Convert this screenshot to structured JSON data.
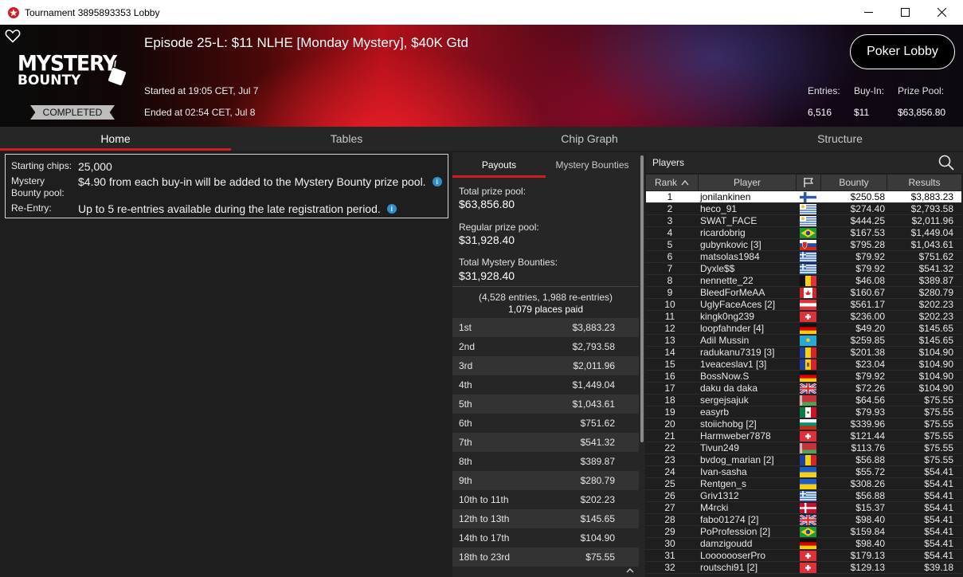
{
  "window": {
    "title": "Tournament 3895893353 Lobby"
  },
  "header": {
    "episode_title": "Episode 25-L: $11 NLHE [Monday Mystery], $40K Gtd",
    "started": "Started at 19:05 CET, Jul 7",
    "ended": "Ended at 02:54 CET, Jul 8",
    "status": "COMPLETED",
    "logo_text_1": "MYSTERY",
    "logo_text_2": "BOUNTY",
    "poker_lobby_label": "Poker Lobby",
    "entries_label": "Entries:",
    "entries_value": "6,516",
    "buyin_label": "Buy-In:",
    "buyin_value": "$11",
    "prizepool_label": "Prize Pool:",
    "prizepool_value": "$63,856.80"
  },
  "tabs": [
    "Home",
    "Tables",
    "Chip Graph",
    "Structure"
  ],
  "home_info": {
    "starting_chips_label": "Starting chips:",
    "starting_chips_value": "25,000",
    "mystery_label_1": "Mystery",
    "mystery_label_2": "Bounty pool:",
    "mystery_value": "$4.90 from each buy-in will be added to the Mystery Bounty prize pool.",
    "reentry_label": "Re-Entry:",
    "reentry_value": "Up to 5 re-entries available during the late registration period."
  },
  "payouts": {
    "tabs": [
      "Payouts",
      "Mystery Bounties"
    ],
    "total_prize_pool_label": "Total prize pool:",
    "total_prize_pool_value": "$63,856.80",
    "regular_prize_pool_label": "Regular prize pool:",
    "regular_prize_pool_value": "$31,928.40",
    "total_mystery_label": "Total Mystery Bounties:",
    "total_mystery_value": "$31,928.40",
    "entries_note": "(4,528 entries, 1,988 re-entries)",
    "places_paid": "1,079 places paid",
    "rows": [
      {
        "place": "1st",
        "amount": "$3,883.23"
      },
      {
        "place": "2nd",
        "amount": "$2,793.58"
      },
      {
        "place": "3rd",
        "amount": "$2,011.96"
      },
      {
        "place": "4th",
        "amount": "$1,449.04"
      },
      {
        "place": "5th",
        "amount": "$1,043.61"
      },
      {
        "place": "6th",
        "amount": "$751.62"
      },
      {
        "place": "7th",
        "amount": "$541.32"
      },
      {
        "place": "8th",
        "amount": "$389.87"
      },
      {
        "place": "9th",
        "amount": "$280.79"
      },
      {
        "place": "10th to 11th",
        "amount": "$202.23"
      },
      {
        "place": "12th to 13th",
        "amount": "$145.65"
      },
      {
        "place": "14th to 17th",
        "amount": "$104.90"
      },
      {
        "place": "18th to 23rd",
        "amount": "$75.55"
      }
    ]
  },
  "players": {
    "title": "Players",
    "columns": [
      "Rank",
      "Player",
      "Bounty",
      "Results"
    ],
    "rows": [
      {
        "rank": "1",
        "name": "jonilankinen",
        "flag": "fi",
        "bounty": "$250.58",
        "result": "$3,883.23"
      },
      {
        "rank": "2",
        "name": "heco_91",
        "flag": "uy",
        "bounty": "$274.40",
        "result": "$2,793.58"
      },
      {
        "rank": "3",
        "name": "SWAT_FACE",
        "flag": "uy",
        "bounty": "$444.25",
        "result": "$2,011.96"
      },
      {
        "rank": "4",
        "name": "ricardobrig",
        "flag": "br",
        "bounty": "$167.53",
        "result": "$1,449.04"
      },
      {
        "rank": "5",
        "name": "gubynkovic [3]",
        "flag": "sk",
        "bounty": "$795.28",
        "result": "$1,043.61"
      },
      {
        "rank": "6",
        "name": "matsolas1984",
        "flag": "gr",
        "bounty": "$79.92",
        "result": "$751.62"
      },
      {
        "rank": "7",
        "name": "Dyxle$$",
        "flag": "gr",
        "bounty": "$79.92",
        "result": "$541.32"
      },
      {
        "rank": "8",
        "name": "nennette_22",
        "flag": "be",
        "bounty": "$46.08",
        "result": "$389.87"
      },
      {
        "rank": "9",
        "name": "BleedForMeAA",
        "flag": "ca",
        "bounty": "$160.67",
        "result": "$280.79"
      },
      {
        "rank": "10",
        "name": "UglyFaceAces [2]",
        "flag": "at",
        "bounty": "$561.17",
        "result": "$202.23"
      },
      {
        "rank": "11",
        "name": "kingk0ng239",
        "flag": "ch",
        "bounty": "$236.00",
        "result": "$202.23"
      },
      {
        "rank": "12",
        "name": "loopfahnder [4]",
        "flag": "de",
        "bounty": "$49.20",
        "result": "$145.65"
      },
      {
        "rank": "13",
        "name": "Adil Mussin",
        "flag": "kz",
        "bounty": "$259.85",
        "result": "$145.65"
      },
      {
        "rank": "14",
        "name": "radukanu7319 [3]",
        "flag": "ro",
        "bounty": "$201.38",
        "result": "$104.90"
      },
      {
        "rank": "15",
        "name": "1veaceslav1 [3]",
        "flag": "md",
        "bounty": "$23.04",
        "result": "$104.90"
      },
      {
        "rank": "16",
        "name": "BossNow.S",
        "flag": "de",
        "bounty": "$79.92",
        "result": "$104.90"
      },
      {
        "rank": "17",
        "name": "daku da daka",
        "flag": "gb",
        "bounty": "$72.26",
        "result": "$104.90"
      },
      {
        "rank": "18",
        "name": "sergejsajuk",
        "flag": "by",
        "bounty": "$64.56",
        "result": "$75.55"
      },
      {
        "rank": "19",
        "name": "easyrb",
        "flag": "mx",
        "bounty": "$79.93",
        "result": "$75.55"
      },
      {
        "rank": "20",
        "name": "stoiichobg [2]",
        "flag": "bg",
        "bounty": "$339.96",
        "result": "$75.55"
      },
      {
        "rank": "21",
        "name": "Harmweber7878",
        "flag": "ch",
        "bounty": "$121.44",
        "result": "$75.55"
      },
      {
        "rank": "22",
        "name": "Tivun249",
        "flag": "by",
        "bounty": "$113.76",
        "result": "$75.55"
      },
      {
        "rank": "23",
        "name": "bvdog_marian [2]",
        "flag": "ro",
        "bounty": "$56.88",
        "result": "$75.55"
      },
      {
        "rank": "24",
        "name": "Ivan-sasha",
        "flag": "ua",
        "bounty": "$55.72",
        "result": "$54.41"
      },
      {
        "rank": "25",
        "name": "Rentgen_s",
        "flag": "ua",
        "bounty": "$308.26",
        "result": "$54.41"
      },
      {
        "rank": "26",
        "name": "Griv1312",
        "flag": "gr",
        "bounty": "$56.88",
        "result": "$54.41"
      },
      {
        "rank": "27",
        "name": "M4rcki",
        "flag": "dk",
        "bounty": "$15.37",
        "result": "$54.41"
      },
      {
        "rank": "28",
        "name": "fabo01274 [2]",
        "flag": "gb",
        "bounty": "$98.40",
        "result": "$54.41"
      },
      {
        "rank": "29",
        "name": "PoProfession [2]",
        "flag": "br",
        "bounty": "$159.84",
        "result": "$54.41"
      },
      {
        "rank": "30",
        "name": "damzigoudd",
        "flag": "de",
        "bounty": "$98.40",
        "result": "$54.41"
      },
      {
        "rank": "31",
        "name": "LooooooserPro",
        "flag": "ch",
        "bounty": "$179.13",
        "result": "$54.41"
      },
      {
        "rank": "32",
        "name": "routschi91 [2]",
        "flag": "ch",
        "bounty": "$129.13",
        "result": "$39.18"
      }
    ]
  }
}
